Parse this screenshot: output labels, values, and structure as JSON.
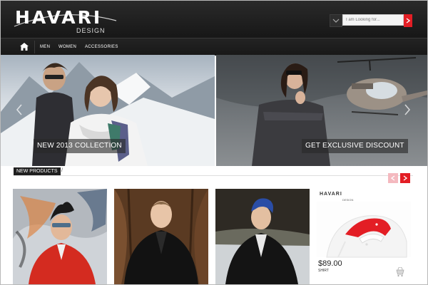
{
  "brand": {
    "logo_main": "HAVARI",
    "logo_sub": "DESIGN"
  },
  "search": {
    "placeholder": "I am Looking for..."
  },
  "nav": {
    "items": [
      "MEN",
      "WOMEN",
      "ACCESSORIES"
    ]
  },
  "banners": [
    {
      "caption": "NEW 2013 COLLECTION"
    },
    {
      "caption": "GET EXCLUSIVE DISCOUNT"
    }
  ],
  "products_section": {
    "title": "NEW PRODUCTS",
    "separator": "/"
  },
  "products": [
    {
      "image": "man-red-jacket-graffiti"
    },
    {
      "image": "man-black-leather-jacket-forest"
    },
    {
      "image": "man-black-jacket-blue-hair"
    },
    {
      "image": "white-shirt-red-collar",
      "logo": "HAVARI",
      "logo_sub": "DESIGN",
      "price": "$89.00",
      "type": "SHIRT"
    }
  ],
  "colors": {
    "accent": "#e31e25",
    "header": "#1c1c1c",
    "accent_light": "#f4b9bf"
  },
  "icons": [
    "home-icon",
    "chevron-down-icon",
    "chevron-right-icon",
    "chevron-left-icon",
    "cart-icon"
  ]
}
